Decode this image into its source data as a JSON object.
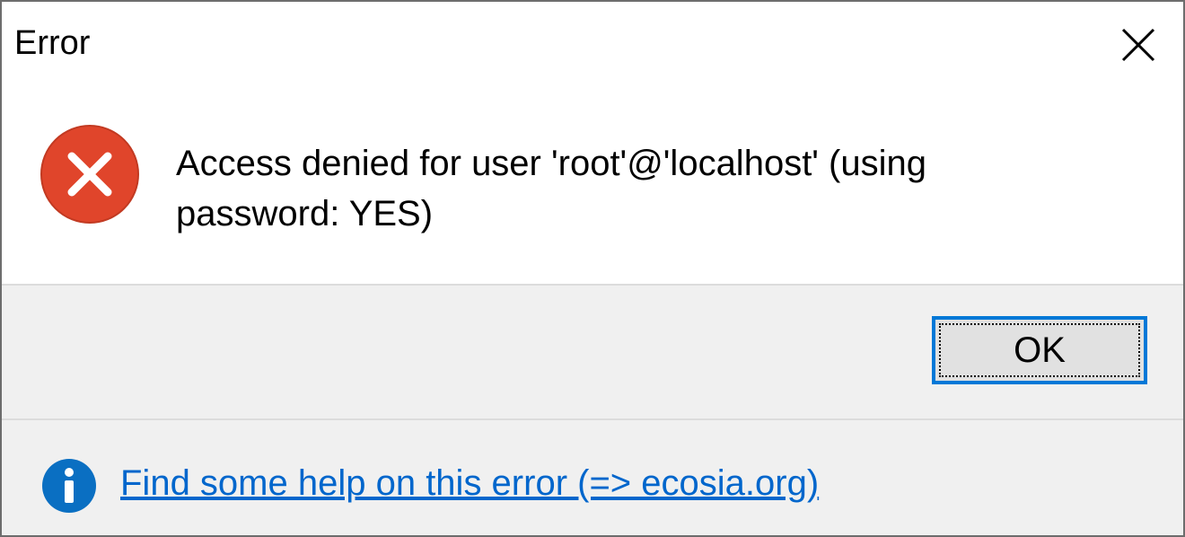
{
  "window": {
    "title": "Error",
    "close_icon": "close-icon"
  },
  "message": {
    "icon": "error-icon",
    "icon_color": "#e0452b",
    "text": "Access denied for user 'root'@'localhost' (using password: YES)"
  },
  "buttons": {
    "ok_label": "OK",
    "accent_color": "#0078d7"
  },
  "footer": {
    "icon": "info-icon",
    "icon_color": "#0a6fc2",
    "link_text": "Find some help on this error (=> ecosia.org)",
    "link_color": "#0066cc"
  }
}
